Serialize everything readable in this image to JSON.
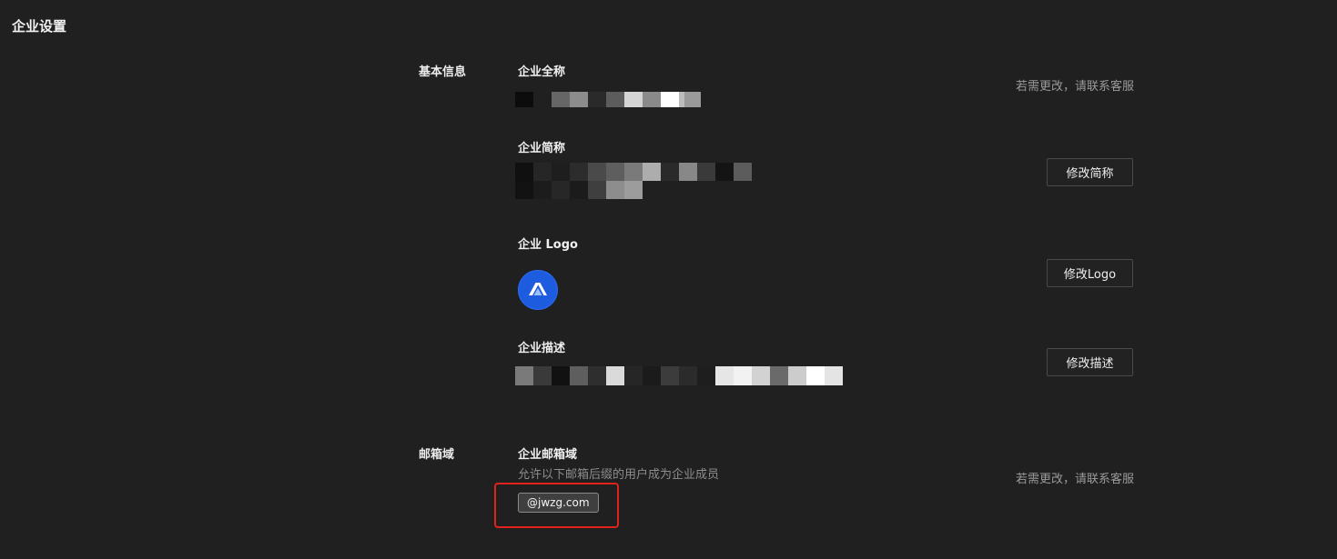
{
  "page": {
    "title": "企业设置"
  },
  "basic_info": {
    "label": "基本信息",
    "full_name": {
      "title": "企业全称",
      "note": "若需更改，请联系客服"
    },
    "short_name": {
      "title": "企业简称",
      "button": "修改简称"
    },
    "logo": {
      "title": "企业 Logo",
      "button": "修改Logo"
    },
    "description": {
      "title": "企业描述",
      "button": "修改描述"
    }
  },
  "email_domain": {
    "label": "邮箱域",
    "title": "企业邮箱域",
    "hint": "允许以下邮箱后缀的用户成为企业成员",
    "domain": "@jwzg.com",
    "note": "若需更改，请联系客服"
  },
  "colors": {
    "background": "#202020",
    "logo_blue": "#1d5bdf",
    "highlight_red": "#e0221c"
  },
  "icons": {
    "logo": "company-logo-icon"
  }
}
